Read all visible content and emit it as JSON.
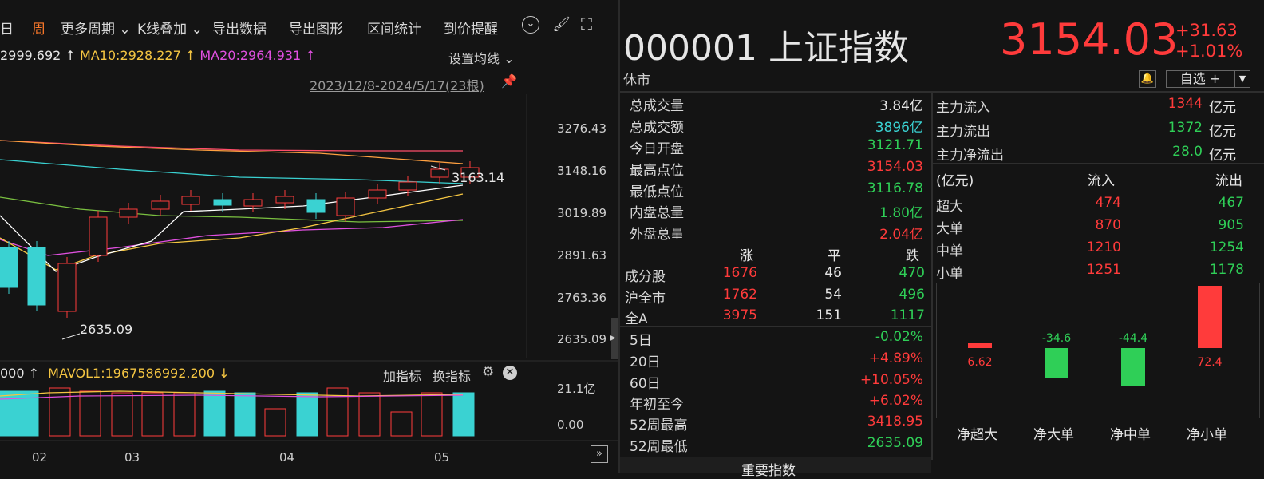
{
  "toolbar": {
    "day": "日",
    "week": "周",
    "more_periods": "更多周期",
    "kline_overlay": "K线叠加",
    "export_data": "导出数据",
    "export_chart": "导出图形",
    "range_stats": "区间统计",
    "price_alert": "到价提醒"
  },
  "ma": {
    "ma5": "2999.692",
    "ma10_label": "MA10:2928.227",
    "ma20_label": "MA20:2964.931",
    "set_ma": "设置均线"
  },
  "date_range": "2023/12/8-2024/5/17(23根)",
  "price_ticks": [
    "3276.43",
    "3148.16",
    "3019.89",
    "2891.63",
    "2763.36",
    "2635.09"
  ],
  "annotations": {
    "high": "3163.14",
    "low": "2635.09"
  },
  "volume": {
    "head": "000",
    "mavol_label": "MAVOL1:1967586992.200",
    "add_indicator": "加指标",
    "switch_indicator": "换指标",
    "ticks": [
      "21.1亿",
      "0.00"
    ]
  },
  "x_ticks": [
    "02",
    "03",
    "04",
    "05"
  ],
  "colors": {
    "up": "#ff3b3b",
    "down": "#3ad2d2",
    "green": "#2fcf57",
    "bg": "#141414"
  },
  "quote": {
    "code_name": "000001 上证指数",
    "price": "3154.03",
    "change": "+31.63",
    "change_pct": "+1.01%",
    "status": "休市",
    "watchlist": "自选 +"
  },
  "stats": [
    {
      "label": "总成交量",
      "value": "3.84亿",
      "color": "white"
    },
    {
      "label": "总成交额",
      "value": "3896亿",
      "color": "cyan"
    },
    {
      "label": "今日开盘",
      "value": "3121.71",
      "color": "green"
    },
    {
      "label": "最高点位",
      "value": "3154.03",
      "color": "red"
    },
    {
      "label": "最低点位",
      "value": "3116.78",
      "color": "green"
    },
    {
      "label": "内盘总量",
      "value": "1.80亿",
      "color": "green"
    },
    {
      "label": "外盘总量",
      "value": "2.04亿",
      "color": "red"
    }
  ],
  "breadth": {
    "header": [
      "涨",
      "平",
      "跌"
    ],
    "rows": [
      {
        "label": "成分股",
        "up": "1676",
        "flat": "46",
        "down": "470"
      },
      {
        "label": "沪全市",
        "up": "1762",
        "flat": "54",
        "down": "496"
      },
      {
        "label": "全A",
        "up": "3975",
        "flat": "151",
        "down": "1117"
      }
    ]
  },
  "periods": [
    {
      "label": "5日",
      "value": "-0.02%",
      "color": "green"
    },
    {
      "label": "20日",
      "value": "+4.89%",
      "color": "red"
    },
    {
      "label": "60日",
      "value": "+10.05%",
      "color": "red"
    },
    {
      "label": "年初至今",
      "value": "+6.02%",
      "color": "red"
    },
    {
      "label": "52周最高",
      "value": "3418.95",
      "color": "red"
    },
    {
      "label": "52周最低",
      "value": "2635.09",
      "color": "green"
    }
  ],
  "bottom_tab": "重要指数",
  "flows": [
    {
      "label": "主力流入",
      "value": "1344",
      "unit": "亿元",
      "color": "red"
    },
    {
      "label": "主力流出",
      "value": "1372",
      "unit": "亿元",
      "color": "green"
    },
    {
      "label": "主力净流出",
      "value": "28.0",
      "unit": "亿元",
      "color": "green"
    }
  ],
  "order_table": {
    "header": [
      "(亿元)",
      "流入",
      "流出"
    ],
    "rows": [
      {
        "label": "超大",
        "in": "474",
        "out": "467"
      },
      {
        "label": "大单",
        "in": "870",
        "out": "905"
      },
      {
        "label": "中单",
        "in": "1210",
        "out": "1254"
      },
      {
        "label": "小单",
        "in": "1251",
        "out": "1178"
      }
    ]
  },
  "chart_data": {
    "type": "bar",
    "categories": [
      "净超大",
      "净大单",
      "净中单",
      "净小单"
    ],
    "values": [
      6.62,
      -34.6,
      -44.4,
      72.4
    ],
    "value_labels": [
      "6.62",
      "-34.6",
      "-44.4",
      "72.4"
    ]
  }
}
